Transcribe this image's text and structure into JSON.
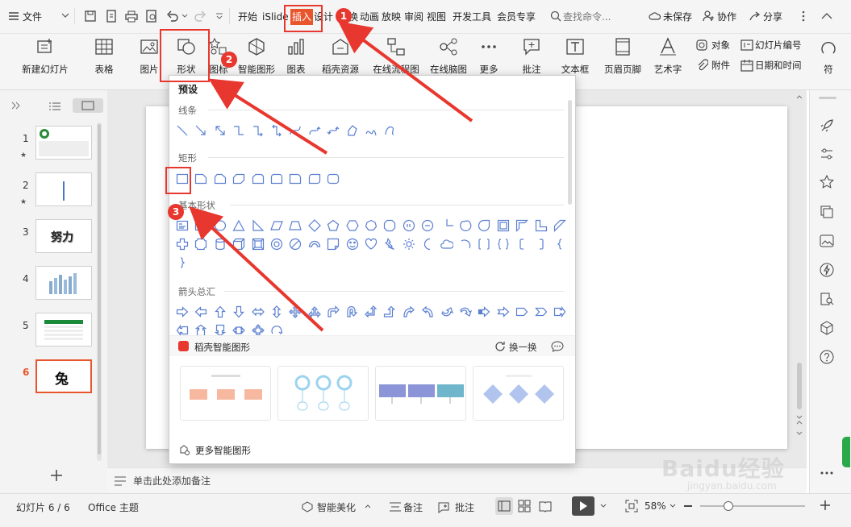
{
  "menubar": {
    "file": "文件",
    "tabs": [
      "开始",
      "iSlide",
      "插入",
      "设计",
      "换",
      "动画",
      "放映",
      "审阅",
      "视图",
      "开发工具",
      "会员专享"
    ],
    "search": "查找命令...",
    "unsaved": "未保存",
    "collab": "协作",
    "share": "分享"
  },
  "ribbon": {
    "new_slide": "新建幻灯片",
    "table": "表格",
    "picture": "图片",
    "shape": "形状",
    "icon": "图标",
    "smart_shape": "智能图形",
    "chart": "图表",
    "daoke": "稻壳资源",
    "flowchart": "在线流程图",
    "mindmap": "在线脑图",
    "more": "更多",
    "comment": "批注",
    "textbox": "文本框",
    "header_footer": "页眉页脚",
    "art_text": "艺术字",
    "object": "对象",
    "slide_number": "幻灯片编号",
    "attachment": "附件",
    "datetime": "日期和时间",
    "symbol": "符"
  },
  "slides": [
    {
      "n": "1"
    },
    {
      "n": "2"
    },
    {
      "n": "3",
      "text": "努力"
    },
    {
      "n": "4"
    },
    {
      "n": "5"
    },
    {
      "n": "6",
      "text": "兔"
    }
  ],
  "shape_panel": {
    "title": "预设",
    "lines": "线条",
    "rect": "矩形",
    "basic": "基本形状",
    "arrows": "箭头总汇",
    "smart_header": "稻壳智能图形",
    "refresh": "换一换",
    "more_smart": "更多智能图形"
  },
  "notes_placeholder": "单击此处添加备注",
  "status": {
    "slide_count": "幻灯片 6 / 6",
    "theme": "Office 主题",
    "beautify": "智能美化",
    "notes": "备注",
    "comments": "批注",
    "zoom": "58%"
  },
  "annotations": [
    "1",
    "2",
    "3"
  ],
  "watermark": {
    "main": "Baidu经验",
    "sub": "jingyan.baidu.com"
  },
  "colors": {
    "accent": "#e8372e",
    "active_tab": "#e8552d",
    "icon_blue": "#5b7fd1"
  }
}
